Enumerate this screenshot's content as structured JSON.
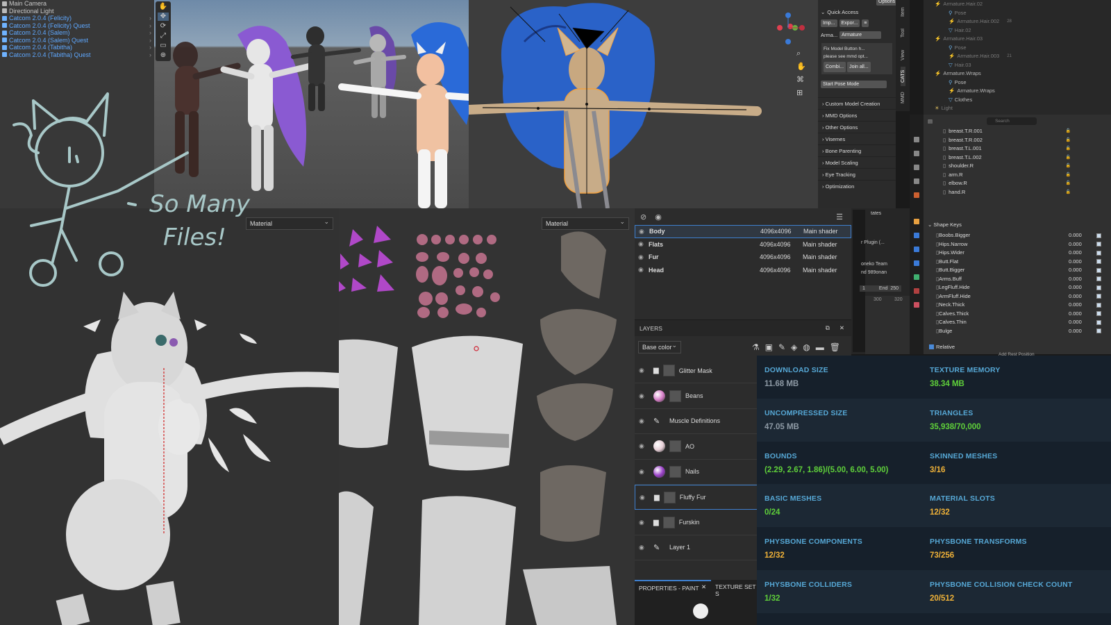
{
  "unity_hierarchy": {
    "items": [
      {
        "label": "Main Camera",
        "kind": "gray"
      },
      {
        "label": "Directional Light",
        "kind": "gray"
      },
      {
        "label": "Catcom 2.0.4 (Felicity)",
        "kind": "blue"
      },
      {
        "label": "Catcom 2.0.4 (Felicity) Quest",
        "kind": "blue"
      },
      {
        "label": "Catcom 2.0.4 (Salem)",
        "kind": "blue"
      },
      {
        "label": "Catcom 2.0.4 (Salem) Quest",
        "kind": "blue"
      },
      {
        "label": "Catcom 2.0.4 (Tabitha)",
        "kind": "blue"
      },
      {
        "label": "Catcom 2.0.4 (Tabitha) Quest",
        "kind": "blue"
      }
    ]
  },
  "blender_npanel": {
    "header": "Quick Access",
    "import_label": "Imp...",
    "export_label": "Expor...",
    "armature_label": "Arma...",
    "armature_value": "Armature",
    "fix_model_text": "Fix Model Button h...",
    "fix_model_note": "please see mmd opt...",
    "combine_label": "Combi...",
    "join_label": "Join all...",
    "pose_mode_label": "Start Pose Mode",
    "sections": [
      "Custom Model Creation",
      "MMD Options",
      "Other Options",
      "Visemes",
      "Bone Parenting",
      "Model Scaling",
      "Eye Tracking",
      "Optimization"
    ],
    "options_label": "Options"
  },
  "blender_vtabs": [
    "Item",
    "Tool",
    "View",
    "CATS",
    "MMD"
  ],
  "outliner": {
    "rows": [
      {
        "label": "Armature.Hair.02",
        "style": "dim",
        "indent": 10
      },
      {
        "label": "Pose",
        "style": "dim",
        "indent": 30
      },
      {
        "label": "Armature.Hair.002",
        "style": "dim",
        "indent": 30,
        "badge": "28"
      },
      {
        "label": "Hair.02",
        "style": "dim",
        "indent": 30
      },
      {
        "label": "Armature.Hair.03",
        "style": "dim",
        "indent": 10
      },
      {
        "label": "Pose",
        "style": "dim",
        "indent": 30
      },
      {
        "label": "Armature.Hair.003",
        "style": "dim",
        "indent": 30,
        "badge": "21"
      },
      {
        "label": "Hair.03",
        "style": "dim",
        "indent": 30
      },
      {
        "label": "Armature.Wraps",
        "style": "normal",
        "indent": 10
      },
      {
        "label": "Pose",
        "style": "normal",
        "indent": 30
      },
      {
        "label": "Armature.Wraps",
        "style": "normal",
        "indent": 30
      },
      {
        "label": "Clothes",
        "style": "normal",
        "indent": 30
      },
      {
        "label": "Light",
        "style": "dim",
        "indent": 10
      }
    ]
  },
  "props": {
    "search_placeholder": "Search",
    "bones": [
      "breast.T.R.001",
      "breast.T.R.002",
      "breast.T.L.001",
      "breast.T.L.002",
      "shoulder.R",
      "arm.R",
      "elbow.R",
      "hand.R"
    ],
    "shape_keys_header": "Shape Keys",
    "shape_keys": [
      {
        "name": "Boobs.Bigger",
        "value": "0.000"
      },
      {
        "name": "Hips.Narrow",
        "value": "0.000"
      },
      {
        "name": "Hips.Wider",
        "value": "0.000"
      },
      {
        "name": "Butt.Flat",
        "value": "0.000"
      },
      {
        "name": "Butt.Bigger",
        "value": "0.000"
      },
      {
        "name": "Arms.Buff",
        "value": "0.000"
      },
      {
        "name": "LegFluff.Hide",
        "value": "0.000"
      },
      {
        "name": "ArmFluff.Hide",
        "value": "0.000"
      },
      {
        "name": "Neck.Thick",
        "value": "0.000"
      },
      {
        "name": "Calves.Thick",
        "value": "0.000"
      },
      {
        "name": "Calves.Thin",
        "value": "0.000"
      },
      {
        "name": "Bulge",
        "value": "0.000"
      }
    ],
    "relative_label": "Relative",
    "add_rest_label": "Add Rest Position"
  },
  "timeline_strip": {
    "tates": "tates",
    "plugin": "r Plugin (...",
    "team": "oneko Team",
    "user": "nd 989onan",
    "start": "1",
    "end_label": "End",
    "end": "250",
    "tick1": "300",
    "tick2": "320"
  },
  "viewport_left": {
    "mode": "Material"
  },
  "viewport_mid": {
    "mode": "Material"
  },
  "texture_sets": [
    {
      "name": "Body",
      "res": "4096x4096",
      "shader": "Main shader",
      "selected": true
    },
    {
      "name": "Flats",
      "res": "4096x4096",
      "shader": "Main shader",
      "selected": false
    },
    {
      "name": "Fur",
      "res": "4096x4096",
      "shader": "Main shader",
      "selected": false
    },
    {
      "name": "Head",
      "res": "4096x4096",
      "shader": "Main shader",
      "selected": false
    }
  ],
  "layers": {
    "title": "LAYERS",
    "channel": "Base color",
    "items": [
      {
        "name": "Glitter Mask",
        "kind": "folder"
      },
      {
        "name": "Beans",
        "kind": "fill",
        "color": "#d77ec8"
      },
      {
        "name": "Muscle Definitions",
        "kind": "paint"
      },
      {
        "name": "AO",
        "kind": "fill",
        "color": "#e8d0d8"
      },
      {
        "name": "Nails",
        "kind": "fill",
        "color": "#9a40c8"
      },
      {
        "name": "Fluffy Fur",
        "kind": "folder",
        "selected": true
      },
      {
        "name": "Furskin",
        "kind": "folder"
      },
      {
        "name": "Layer 1",
        "kind": "paint"
      }
    ]
  },
  "properties_paint": {
    "tab1": "PROPERTIES - PAINT",
    "tab2": "TEXTURE SET S"
  },
  "doodle_text": {
    "line1": "So Many",
    "line2": "Files!"
  },
  "stats": [
    [
      {
        "label": "DOWNLOAD SIZE",
        "value": "11.68 MB",
        "color": "gray"
      },
      {
        "label": "TEXTURE MEMORY",
        "value": "38.34 MB",
        "color": "green"
      }
    ],
    [
      {
        "label": "UNCOMPRESSED SIZE",
        "value": "47.05 MB",
        "color": "gray"
      },
      {
        "label": "TRIANGLES",
        "value": "35,938/70,000",
        "color": "green"
      }
    ],
    [
      {
        "label": "BOUNDS",
        "value": "(2.29, 2.67, 1.86)/(5.00, 6.00, 5.00)",
        "color": "green"
      },
      {
        "label": "SKINNED MESHES",
        "value": "3/16",
        "color": "orange"
      }
    ],
    [
      {
        "label": "BASIC MESHES",
        "value": "0/24",
        "color": "green"
      },
      {
        "label": "MATERIAL SLOTS",
        "value": "12/32",
        "color": "orange"
      }
    ],
    [
      {
        "label": "PHYSBONE COMPONENTS",
        "value": "12/32",
        "color": "orange"
      },
      {
        "label": "PHYSBONE TRANSFORMS",
        "value": "73/256",
        "color": "orange"
      }
    ],
    [
      {
        "label": "PHYSBONE COLLIDERS",
        "value": "1/32",
        "color": "green"
      },
      {
        "label": "PHYSBONE COLLISION CHECK COUNT",
        "value": "20/512",
        "color": "orange"
      }
    ]
  ]
}
